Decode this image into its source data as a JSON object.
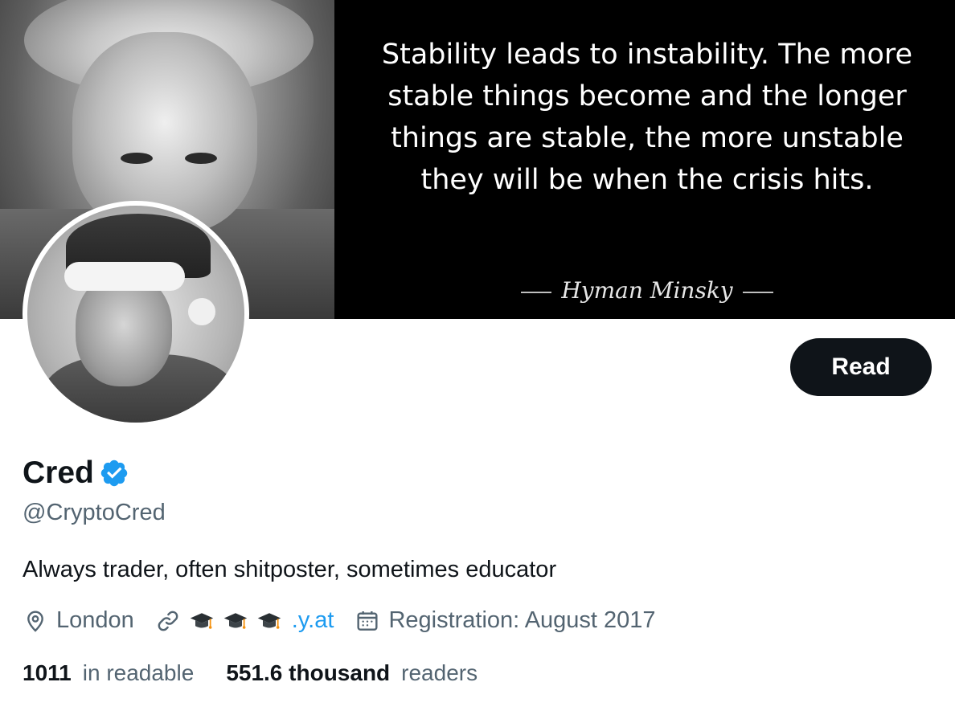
{
  "banner": {
    "quote": "Stability leads to instability. The more stable things become and the longer things are stable, the more unstable they will be when the crisis hits.",
    "author": "Hyman Minsky"
  },
  "actions": {
    "read_label": "Read"
  },
  "profile": {
    "name": "Cred",
    "handle": "@CryptoCred",
    "bio": "Always trader, often shitposter, sometimes educator",
    "location": "London",
    "link_text": ".y.at",
    "link_emoji": [
      "🎓",
      "🎓",
      "🎓"
    ],
    "registration": "Registration: August 2017",
    "verified": true
  },
  "stats": {
    "following_count": "1011",
    "following_label": "in readable",
    "followers_count": "551.6 thousand",
    "followers_label": "readers"
  },
  "colors": {
    "accent": "#1d9bf0",
    "text_primary": "#0f1419",
    "text_secondary": "#536471",
    "button_bg": "#0f1419"
  },
  "icons": [
    "verified-badge-icon",
    "location-pin-icon",
    "link-icon",
    "graduation-cap-icon",
    "calendar-icon"
  ]
}
